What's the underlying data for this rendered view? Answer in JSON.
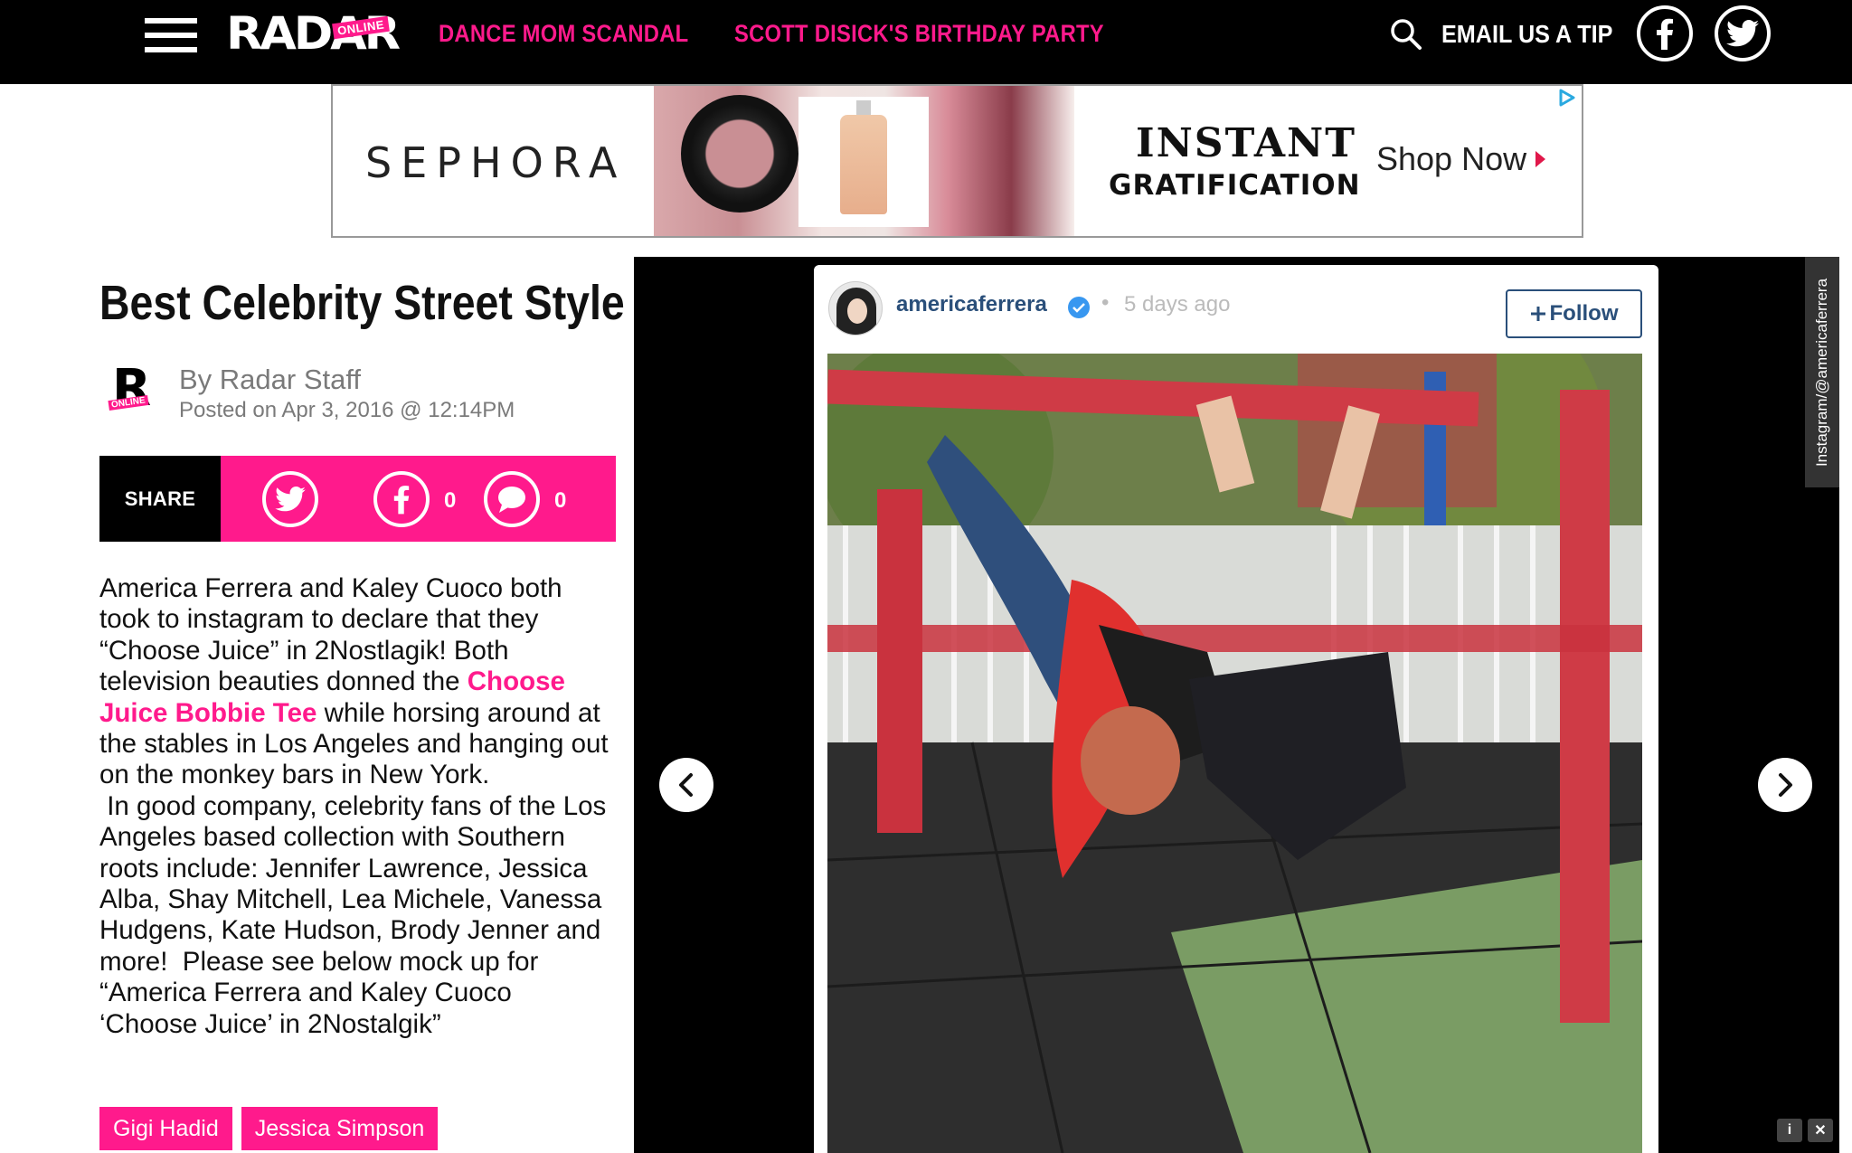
{
  "header": {
    "logo_text": "RADAR",
    "logo_badge": "ONLINE",
    "nav": [
      "DANCE MOM SCANDAL",
      "SCOTT DISICK'S BIRTHDAY PARTY"
    ],
    "tip_label": "EMAIL US A TIP",
    "accent": "#ff1a8c"
  },
  "ad": {
    "brand": "SEPHORA",
    "headline_1": "INSTANT",
    "headline_2": "GRATIFICATION",
    "cta": "Shop Now"
  },
  "article": {
    "title": "Best Celebrity Street Style",
    "author_avatar_letter": "R",
    "author_avatar_badge": "ONLINE",
    "byline": "By Radar Staff",
    "posted": "Posted on Apr 3, 2016 @ 12:14PM",
    "share": {
      "label": "SHARE",
      "facebook_count": "0",
      "comment_count": "0"
    },
    "body": {
      "p1_a": "America Ferrera and Kaley Cuoco both took to instagram to declare that they “Choose Juice” in 2Nostlagik! Both television beauties donned the ",
      "p1_link": "Choose Juice Bobbie Tee",
      "p1_b": " while horsing around at the stables in Los Angeles and hanging out on the monkey bars in New York.",
      "p2": " In good company, celebrity fans of the Los Angeles based collection with Southern roots include: Jennifer Lawrence, Jessica Alba, Shay Mitchell, Lea Michele, Vanessa Hudgens, Kate Hudson, Brody Jenner and more!  Please see below mock up for “America Ferrera and Kaley Cuoco ‘Choose Juice’ in 2Nostalgik”"
    },
    "tags": [
      "Gigi Hadid",
      "Jessica Simpson"
    ]
  },
  "gallery": {
    "instagram": {
      "username": "americaferrera",
      "time": "5 days ago",
      "follow_label": "Follow"
    },
    "credit": "Instagram/@americaferrera"
  }
}
